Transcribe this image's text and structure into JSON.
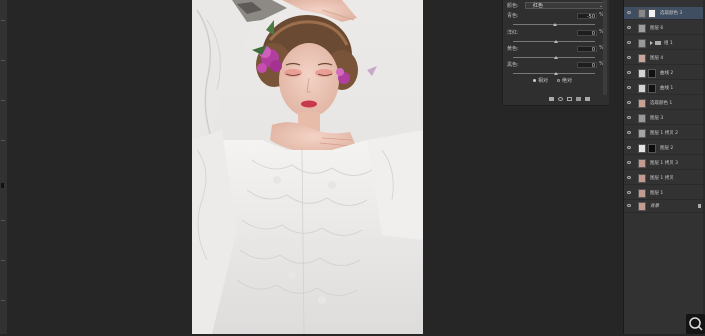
{
  "properties": {
    "color_label": "颜色:",
    "color_value": "红色",
    "accent_color": "#c0392b",
    "sliders": [
      {
        "label": "青色:",
        "value": "-50",
        "unit": "%"
      },
      {
        "label": "洋红:",
        "value": "0",
        "unit": "%"
      },
      {
        "label": "黄色:",
        "value": "0",
        "unit": "%"
      },
      {
        "label": "黑色:",
        "value": "0",
        "unit": "%"
      }
    ],
    "mode_relative": "相对",
    "mode_absolute": "绝对"
  },
  "layers": [
    {
      "name": "选取颜色 3",
      "type": "adjustment",
      "selected": true
    },
    {
      "name": "图层 6",
      "type": "pixel"
    },
    {
      "name": "组 1",
      "type": "group"
    },
    {
      "name": "图层 4",
      "type": "pixel"
    },
    {
      "name": "曲线 2",
      "type": "adjustment-mask"
    },
    {
      "name": "曲线 1",
      "type": "adjustment-mask"
    },
    {
      "name": "选取颜色 1",
      "type": "pixel-photo"
    },
    {
      "name": "图层 3",
      "type": "pixel"
    },
    {
      "name": "图层 1 拷贝 2",
      "type": "pixel"
    },
    {
      "name": "图层 2",
      "type": "mask"
    },
    {
      "name": "图层 1 拷贝 3",
      "type": "pixel-photo"
    },
    {
      "name": "图层 1 拷贝",
      "type": "pixel-photo"
    },
    {
      "name": "图层 1",
      "type": "pixel-photo"
    },
    {
      "name": "背景",
      "type": "background"
    }
  ]
}
